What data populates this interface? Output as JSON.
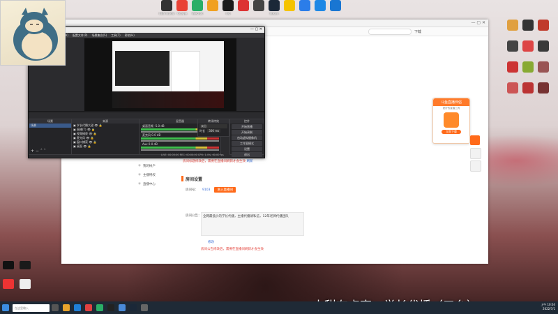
{
  "desktop": {
    "top_icons": [
      {
        "label": "OBS Studio",
        "color": "#333333"
      },
      {
        "label": "Google",
        "color": "#e94235"
      },
      {
        "label": "WeChat",
        "color": "#2aae67"
      },
      {
        "label": "",
        "color": "#f0a020"
      },
      {
        "label": "QQ",
        "color": "#1a1a1a"
      },
      {
        "label": "",
        "color": "#d33"
      },
      {
        "label": "",
        "color": "#444"
      },
      {
        "label": "Steam",
        "color": "#1b2838"
      },
      {
        "label": "",
        "color": "#f5c300"
      },
      {
        "label": "",
        "color": "#2b7de9"
      },
      {
        "label": "",
        "color": "#1e88e5"
      },
      {
        "label": "",
        "color": "#1976d2"
      }
    ],
    "right_icons": [
      {
        "label": "",
        "color": "#e0a040"
      },
      {
        "label": "",
        "color": "#333"
      },
      {
        "label": "",
        "color": "#c03a2b"
      },
      {
        "label": "",
        "color": "#444"
      },
      {
        "label": "",
        "color": "#d44"
      },
      {
        "label": "",
        "color": "#3a3a3a"
      },
      {
        "label": "",
        "color": "#c33"
      },
      {
        "label": "",
        "color": "#8a3"
      },
      {
        "label": "",
        "color": "#955"
      },
      {
        "label": "",
        "color": "#c55"
      },
      {
        "label": "",
        "color": "#b33"
      },
      {
        "label": "",
        "color": "#733"
      }
    ]
  },
  "browser": {
    "address_placeholder": "",
    "tabs_right": "下载",
    "sidebar": [
      {
        "label": "我的消息",
        "icon": "message-icon"
      },
      {
        "label": "我的帐户",
        "icon": "account-icon"
      },
      {
        "label": "主播特权",
        "icon": "star-icon"
      },
      {
        "label": "直播中心",
        "icon": "home-icon"
      }
    ],
    "section_title": "房间设置",
    "room_label": "房间号：",
    "room_value": "9103",
    "room_button": "进入直播间",
    "notice_label": "房间公告：",
    "notice_text": "全网最低价的学长代播，主播代播请私信，12年老牌代播团队",
    "hint_red": "房间公告修改后，需要在直播间刷新才会生效",
    "hint_blue": "修改",
    "top_hint_red": "房间标题修改后，需要在直播间刷新才会生效",
    "top_hint_blue": "刷新"
  },
  "promo": {
    "title": "斗鱼直播伴侣",
    "subtitle": "更好的直播工具",
    "button": "立即下载"
  },
  "obs": {
    "title": "斗鱼OBS",
    "menu": [
      "文件(F)",
      "编辑(E)",
      "视图(V)",
      "配置文件(P)",
      "场景集合(S)",
      "工具(T)",
      "帮助(H)"
    ],
    "scenes_header": "场景",
    "sources_header": "来源",
    "mixer_header": "混音器",
    "transitions_header": "转场特效",
    "controls_header": "控件",
    "scene_items": [
      "场景"
    ],
    "source_items": [
      "学长代播大甜",
      "直播(T)",
      "视频捕获",
      "麦克风",
      "窗口捕获",
      "桌面"
    ],
    "mixer_items": [
      "桌面音频",
      "麦克风",
      "Aux"
    ],
    "mixer_db": [
      "-5.0 dB",
      "0.0 dB",
      "0.0 dB"
    ],
    "transition_value": "淡出",
    "duration_label": "时长",
    "duration_value": "300 ms",
    "controls": [
      "开始直播",
      "开始录制",
      "启动虚拟摄像机",
      "工作室模式",
      "设置",
      "退出"
    ],
    "status": "LIVE: 00:00:00   REC: 00:00:00   CPU: 1.4%, 60.00 fps"
  },
  "caption": "大甜有点事，学长代播（五台）",
  "taskbar": {
    "search_placeholder": "在这里输入",
    "clock_time": "上午 10:04",
    "clock_date": "2022/7/1"
  }
}
